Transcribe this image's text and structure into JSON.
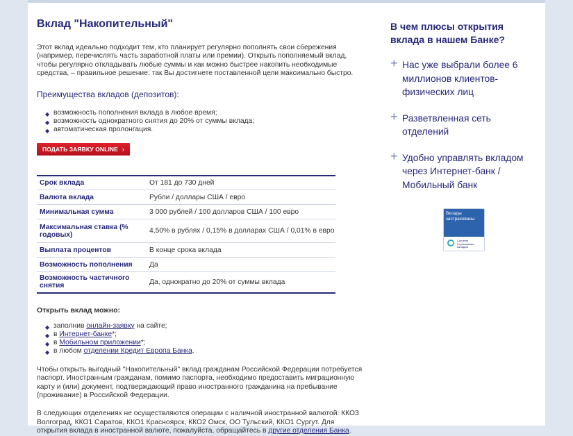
{
  "main": {
    "title": "Вклад \"Накопительный\"",
    "intro": "Этот вклад идеально подходит тем, кто планирует регулярно пополнять свои сбережения (например, перечислять часть заработной платы или премии). Открыть пополняемый вклад, чтобы регулярно откладывать любые суммы и как можно быстрее накопить необходимые средства, – правильное решение: так Вы достигнете поставленной цели максимально быстро.",
    "advantages_head": "Преимущества вкладов (депозитов):",
    "advantages": [
      "возможность пополнения вклада в любое время;",
      "возможность однократного снятия до 20% от суммы вклада;",
      "автоматическая пролонгация."
    ],
    "apply_button": "ПОДАТЬ ЗАЯВКУ ONLINE",
    "params": [
      {
        "k": "Срок вклада",
        "v": "От 181 до 730 дней"
      },
      {
        "k": "Валюта вклада",
        "v": "Рубли / доллары США / евро"
      },
      {
        "k": "Минимальная сумма",
        "v": "3 000 рублей / 100 долларов США / 100 евро"
      },
      {
        "k": "Максимальная ставка (% годовых)",
        "v": "4,50% в рублях / 0,15% в долларах США / 0,01% в евро"
      },
      {
        "k": "Выплата процентов",
        "v": "В конце срока вклада"
      },
      {
        "k": "Возможность пополнения",
        "v": "Да"
      },
      {
        "k": "Возможность частичного снятия",
        "v": "Да, однократно до 20% от суммы вклада"
      }
    ],
    "open_head": "Открыть вклад можно:",
    "open_ways": [
      {
        "pre": "заполнив ",
        "link": "онлайн-заявку",
        "post": " на сайте;"
      },
      {
        "pre": "в ",
        "link": "Интернет-банке",
        "post": "*;"
      },
      {
        "pre": "в ",
        "link": "Мобильном приложении",
        "post": "*;"
      },
      {
        "pre": "в любом ",
        "link": "отделении Кредит Европа Банка",
        "post": "."
      }
    ],
    "foreign_para": "Чтобы открыть выгодный \"Накопительный\" вклад гражданам Российской Федерации потребуется паспорт. Иностранным гражданам, помимо паспорта, необходимо предоставить миграционную карту и (или) документ, подтверждающий право иностранного гражданина на пребывание (проживание) в Российской Федерации.",
    "branches_para_pre": "В следующих отделениях не осуществляются операции с наличной иностранной валютой: ККО3 Волгоград, ККО1 Саратов, ККО1 Красноярск, ККО2 Омск, ОО Тульский, ККО1 Сургут. Для открытия вклада в иностранной валюте, пожалуйста, обращайтесь в ",
    "branches_link": "другие отделения Банка",
    "branches_para_post": "."
  },
  "side": {
    "title": "В чем плюсы открытия вклада в нашем Банке?",
    "items": [
      "Нас уже выбрали более 6 миллионов клиентов-физических лиц",
      "Разветвленная сеть отделений",
      "Удобно управлять вкладом через Интернет-банк / Мобильный банк"
    ],
    "badge_top": "Вклады застрахованы",
    "badge_bottom": "Система Страхования Вкладов"
  },
  "colors": {
    "brand": "#27287a",
    "button": "#d11a24",
    "badge": "#2d63ad"
  }
}
